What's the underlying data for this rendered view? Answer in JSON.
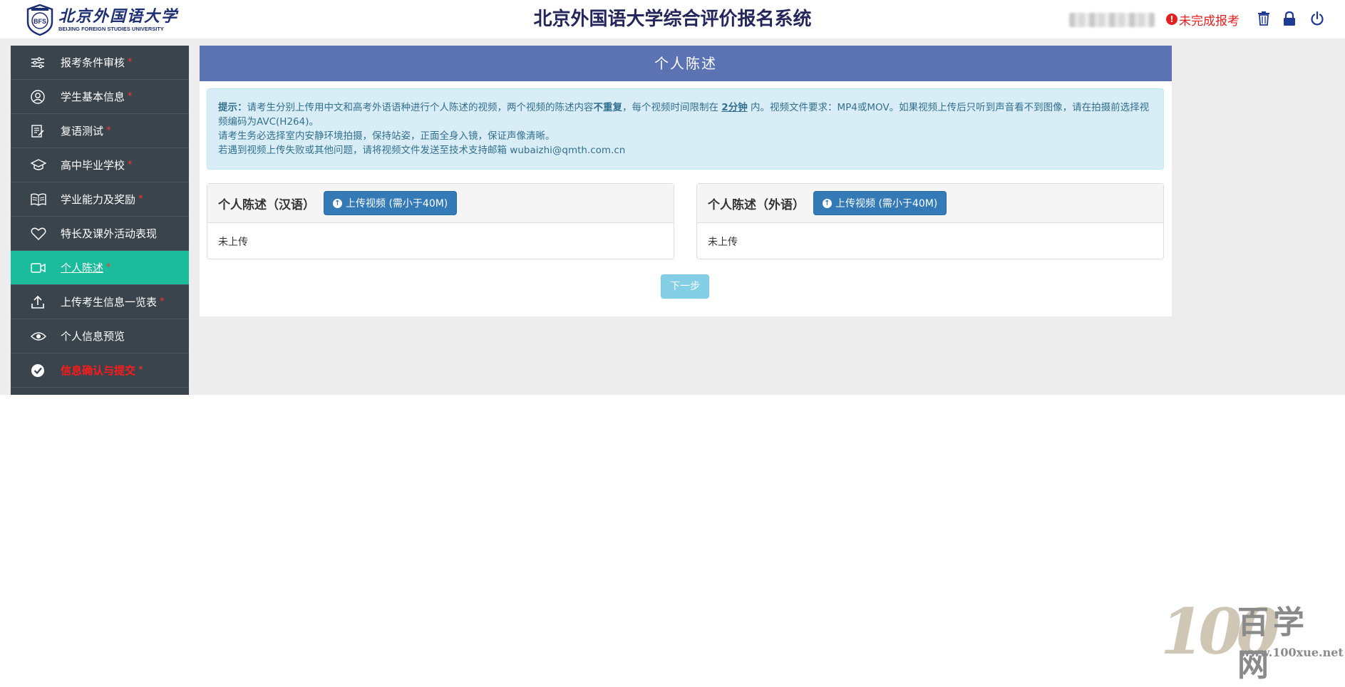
{
  "header": {
    "logo_cn": "北京外国语大学",
    "logo_en": "BEIJING FOREIGN STUDIES UNIVERSITY",
    "site_title": "北京外国语大学综合评价报名系统",
    "status_text": "未完成报考",
    "icons": [
      "delete-icon",
      "lock-icon",
      "power-icon"
    ]
  },
  "sidebar": {
    "items": [
      {
        "label": "报考条件审核",
        "required": "*",
        "icon": "sliders-icon"
      },
      {
        "label": "学生基本信息",
        "required": "*",
        "icon": "user-icon"
      },
      {
        "label": "复语测试",
        "required": "*",
        "icon": "edit-document-icon"
      },
      {
        "label": "高中毕业学校",
        "required": "*",
        "icon": "graduation-cap-icon"
      },
      {
        "label": "学业能力及奖励",
        "required": "*",
        "icon": "book-icon"
      },
      {
        "label": "特长及课外活动表现",
        "required": "",
        "icon": "heart-icon"
      },
      {
        "label": "个人陈述",
        "required": "*",
        "icon": "video-icon",
        "active": true
      },
      {
        "label": "上传考生信息一览表",
        "required": "*",
        "icon": "upload-icon"
      },
      {
        "label": "个人信息预览",
        "required": "",
        "icon": "eye-icon"
      },
      {
        "label": "信息确认与提交",
        "required": "*",
        "icon": "check-circle-icon"
      }
    ]
  },
  "main": {
    "title": "个人陈述",
    "tip": {
      "label": "提示：",
      "line1_a": "请考生分别上传用中文和高考外语语种进行个人陈述的视频，两个视频的陈述内容",
      "line1_b": "不重复",
      "line1_c": "，每个视频时间限制在 ",
      "line1_d": "2分钟",
      "line1_e": " 内。视频文件要求：MP4或MOV。如果视频上传后只听到声音看不到图像，请在拍摄前选择视频编码为AVC(H264)。",
      "line2": "请考生务必选择室内安静环境拍摄，保持站姿，正面全身入镜，保证声像清晰。",
      "line3": "若遇到视频上传失败或其他问题，请将视频文件发送至技术支持邮箱 wubaizhi@qmth.com.cn"
    },
    "cards": [
      {
        "title": "个人陈述（汉语）",
        "button": "上传视频 (需小于40M)",
        "status": "未上传"
      },
      {
        "title": "个人陈述（外语）",
        "button": "上传视频 (需小于40M)",
        "status": "未上传"
      }
    ],
    "next_button": "下一步"
  },
  "watermark": {
    "number": "100",
    "cn": "百学网",
    "url": "www.100xue.net"
  },
  "colors": {
    "sidebar_bg": "#3a444c",
    "active_item": "#1abc9c",
    "panel_header": "#5b72b3",
    "primary_button": "#337ab7",
    "next_button": "#5bc0de",
    "status_red": "#e61e1e"
  }
}
